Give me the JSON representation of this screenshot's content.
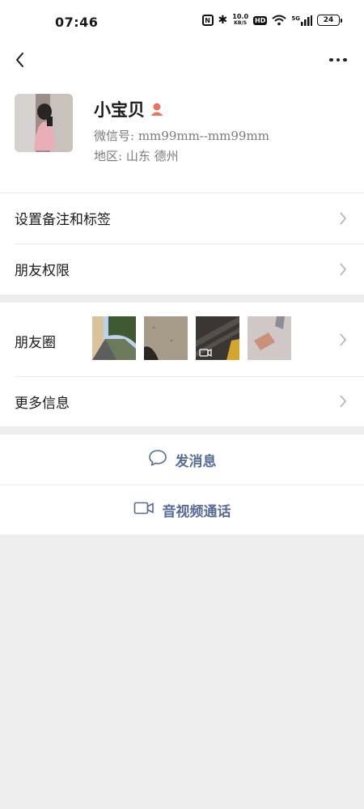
{
  "status_bar": {
    "time": "07:46",
    "nfc_label": "N",
    "bluetooth_glyph": "✱",
    "speed_value": "10.0",
    "speed_unit": "KB/S",
    "hd_label": "HD",
    "signal_label": "5G",
    "battery": "24"
  },
  "nav": {
    "back_icon": "chevron-left-icon",
    "more_icon": "more-dots-icon"
  },
  "profile": {
    "nickname": "小宝贝",
    "wechat_id": "微信号: mm99mm--mm99mm",
    "region": "地区: 山东  德州",
    "accent_color": "#e8735a"
  },
  "menu": {
    "remark_tags": "设置备注和标签",
    "friend_permissions": "朋友权限",
    "moments": "朋友圈",
    "more_info": "更多信息"
  },
  "actions": {
    "send_message": "发消息",
    "video_call": "音视频通话",
    "link_color": "#576b95"
  }
}
